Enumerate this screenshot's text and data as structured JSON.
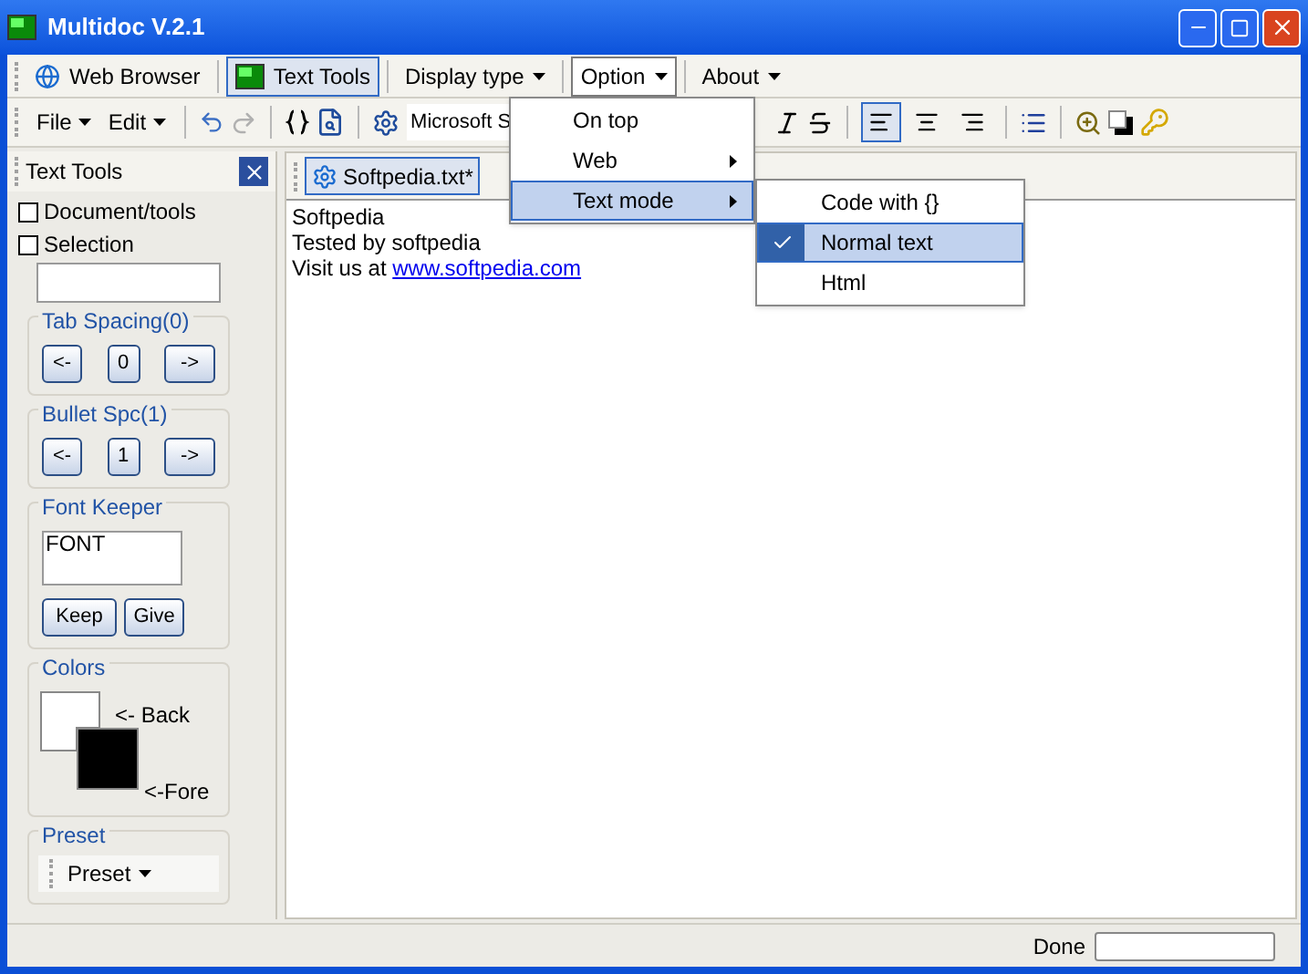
{
  "window": {
    "title": "Multidoc V.2.1"
  },
  "toolbar": [
    {
      "label": "Web Browser",
      "kind": "browser",
      "selected": false
    },
    {
      "label": "Text Tools",
      "kind": "tools",
      "selected": true
    },
    {
      "label": "Display type",
      "kind": "dropdown",
      "selected": false
    },
    {
      "label": "Option",
      "kind": "dropdown",
      "selected": true
    },
    {
      "label": "About",
      "kind": "dropdown",
      "selected": false
    }
  ],
  "format_bar": {
    "menus": [
      "File",
      "Edit"
    ],
    "font": "Microsoft S",
    "align": [
      {
        "kind": "left",
        "selected": true
      },
      {
        "kind": "center",
        "selected": false
      },
      {
        "kind": "right",
        "selected": false
      }
    ]
  },
  "option_menu": [
    {
      "label": "On top",
      "submenu": false,
      "selected": false
    },
    {
      "label": "Web",
      "submenu": true,
      "selected": false
    },
    {
      "label": "Text mode",
      "submenu": true,
      "selected": true
    }
  ],
  "text_mode_menu": [
    {
      "label": "Code with {}",
      "checked": false,
      "selected": false
    },
    {
      "label": "Normal text",
      "checked": true,
      "selected": true
    },
    {
      "label": "Html",
      "checked": false,
      "selected": false
    }
  ],
  "side_panel": {
    "title": "Text Tools",
    "sections": [
      "Document/tools",
      "Selection"
    ],
    "tab_spacing": {
      "title": "Tab Spacing(0)",
      "buttons": [
        "<-",
        "0",
        "->"
      ]
    },
    "bullet_spacing": {
      "title": "Bullet Spc(1)",
      "buttons": [
        "<-",
        "1",
        "->"
      ]
    },
    "font_keeper": {
      "title": "Font Keeper",
      "value": "FONT",
      "buttons": [
        "Keep",
        "Give"
      ]
    },
    "colors": {
      "title": "Colors",
      "items": [
        {
          "label": "<- Back",
          "color": "#ffffff"
        },
        {
          "label": "<-Fore",
          "color": "#000000"
        }
      ]
    },
    "preset": {
      "title": "Preset",
      "button": "Preset"
    }
  },
  "editor": {
    "tab": {
      "label": "Softpedia.txt*",
      "selected": true
    },
    "lines": [
      "Softpedia",
      "Tested by softpedia"
    ],
    "link_prefix": "Visit us at ",
    "link": "www.softpedia.com"
  },
  "status_bar": {
    "text": "Done",
    "progress": {
      "level": 0
    }
  }
}
